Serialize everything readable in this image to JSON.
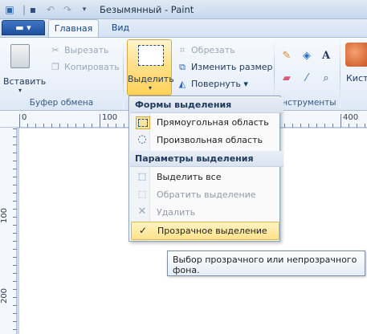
{
  "window": {
    "title": "Безымянный - Paint"
  },
  "quick_access": [
    "save-icon",
    "undo-icon",
    "redo-icon",
    "customize-icon"
  ],
  "tabs": {
    "menu": "▬ ▾",
    "home": "Главная",
    "view": "Вид"
  },
  "clipboard": {
    "paste": "Вставить",
    "cut": "Вырезать",
    "copy": "Копировать",
    "group_label": "Буфер обмена"
  },
  "image": {
    "select": "Выделить",
    "crop": "Обрезать",
    "resize": "Изменить размер",
    "rotate": "Повернуть ▾"
  },
  "tools": {
    "group_label": "Инструменты"
  },
  "brushes": {
    "label": "Кист"
  },
  "ruler": {
    "top_ticks": [
      "0",
      "100",
      "400"
    ],
    "left_ticks": [
      "100",
      "200"
    ]
  },
  "dropdown": {
    "section1": "Формы выделения",
    "rect": "Прямоугольная область",
    "freeform": "Произвольная область",
    "section2": "Параметры выделения",
    "select_all": "Выделить все",
    "invert": "Обратить выделение",
    "delete": "Удалить",
    "transparent": "Прозрачное выделение",
    "check": "✓"
  },
  "tooltip": {
    "text": "Выбор прозрачного или непрозрачного фона."
  },
  "colors": {
    "accent": "#ffd25a",
    "ribbon": "#e9f0f9",
    "workspace": "#c9d6e8"
  }
}
